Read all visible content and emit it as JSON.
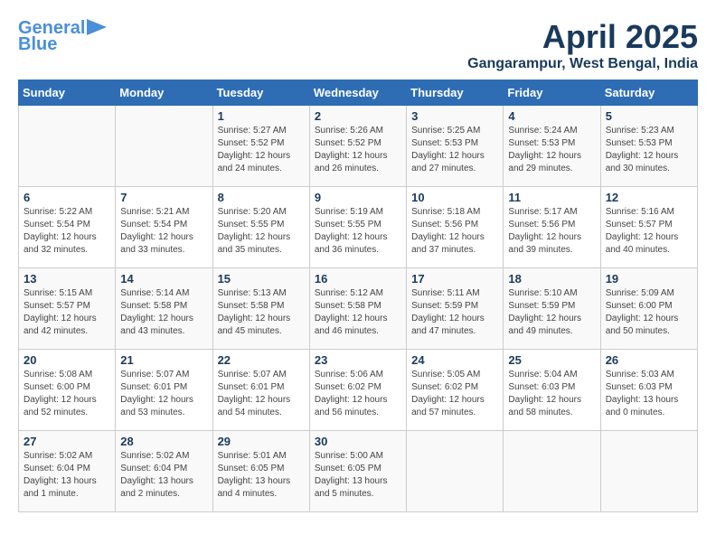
{
  "header": {
    "logo_line1": "General",
    "logo_line2": "Blue",
    "month_year": "April 2025",
    "location": "Gangarampur, West Bengal, India"
  },
  "days_of_week": [
    "Sunday",
    "Monday",
    "Tuesday",
    "Wednesday",
    "Thursday",
    "Friday",
    "Saturday"
  ],
  "weeks": [
    [
      {
        "day": "",
        "info": ""
      },
      {
        "day": "",
        "info": ""
      },
      {
        "day": "1",
        "info": "Sunrise: 5:27 AM\nSunset: 5:52 PM\nDaylight: 12 hours\nand 24 minutes."
      },
      {
        "day": "2",
        "info": "Sunrise: 5:26 AM\nSunset: 5:52 PM\nDaylight: 12 hours\nand 26 minutes."
      },
      {
        "day": "3",
        "info": "Sunrise: 5:25 AM\nSunset: 5:53 PM\nDaylight: 12 hours\nand 27 minutes."
      },
      {
        "day": "4",
        "info": "Sunrise: 5:24 AM\nSunset: 5:53 PM\nDaylight: 12 hours\nand 29 minutes."
      },
      {
        "day": "5",
        "info": "Sunrise: 5:23 AM\nSunset: 5:53 PM\nDaylight: 12 hours\nand 30 minutes."
      }
    ],
    [
      {
        "day": "6",
        "info": "Sunrise: 5:22 AM\nSunset: 5:54 PM\nDaylight: 12 hours\nand 32 minutes."
      },
      {
        "day": "7",
        "info": "Sunrise: 5:21 AM\nSunset: 5:54 PM\nDaylight: 12 hours\nand 33 minutes."
      },
      {
        "day": "8",
        "info": "Sunrise: 5:20 AM\nSunset: 5:55 PM\nDaylight: 12 hours\nand 35 minutes."
      },
      {
        "day": "9",
        "info": "Sunrise: 5:19 AM\nSunset: 5:55 PM\nDaylight: 12 hours\nand 36 minutes."
      },
      {
        "day": "10",
        "info": "Sunrise: 5:18 AM\nSunset: 5:56 PM\nDaylight: 12 hours\nand 37 minutes."
      },
      {
        "day": "11",
        "info": "Sunrise: 5:17 AM\nSunset: 5:56 PM\nDaylight: 12 hours\nand 39 minutes."
      },
      {
        "day": "12",
        "info": "Sunrise: 5:16 AM\nSunset: 5:57 PM\nDaylight: 12 hours\nand 40 minutes."
      }
    ],
    [
      {
        "day": "13",
        "info": "Sunrise: 5:15 AM\nSunset: 5:57 PM\nDaylight: 12 hours\nand 42 minutes."
      },
      {
        "day": "14",
        "info": "Sunrise: 5:14 AM\nSunset: 5:58 PM\nDaylight: 12 hours\nand 43 minutes."
      },
      {
        "day": "15",
        "info": "Sunrise: 5:13 AM\nSunset: 5:58 PM\nDaylight: 12 hours\nand 45 minutes."
      },
      {
        "day": "16",
        "info": "Sunrise: 5:12 AM\nSunset: 5:58 PM\nDaylight: 12 hours\nand 46 minutes."
      },
      {
        "day": "17",
        "info": "Sunrise: 5:11 AM\nSunset: 5:59 PM\nDaylight: 12 hours\nand 47 minutes."
      },
      {
        "day": "18",
        "info": "Sunrise: 5:10 AM\nSunset: 5:59 PM\nDaylight: 12 hours\nand 49 minutes."
      },
      {
        "day": "19",
        "info": "Sunrise: 5:09 AM\nSunset: 6:00 PM\nDaylight: 12 hours\nand 50 minutes."
      }
    ],
    [
      {
        "day": "20",
        "info": "Sunrise: 5:08 AM\nSunset: 6:00 PM\nDaylight: 12 hours\nand 52 minutes."
      },
      {
        "day": "21",
        "info": "Sunrise: 5:07 AM\nSunset: 6:01 PM\nDaylight: 12 hours\nand 53 minutes."
      },
      {
        "day": "22",
        "info": "Sunrise: 5:07 AM\nSunset: 6:01 PM\nDaylight: 12 hours\nand 54 minutes."
      },
      {
        "day": "23",
        "info": "Sunrise: 5:06 AM\nSunset: 6:02 PM\nDaylight: 12 hours\nand 56 minutes."
      },
      {
        "day": "24",
        "info": "Sunrise: 5:05 AM\nSunset: 6:02 PM\nDaylight: 12 hours\nand 57 minutes."
      },
      {
        "day": "25",
        "info": "Sunrise: 5:04 AM\nSunset: 6:03 PM\nDaylight: 12 hours\nand 58 minutes."
      },
      {
        "day": "26",
        "info": "Sunrise: 5:03 AM\nSunset: 6:03 PM\nDaylight: 13 hours\nand 0 minutes."
      }
    ],
    [
      {
        "day": "27",
        "info": "Sunrise: 5:02 AM\nSunset: 6:04 PM\nDaylight: 13 hours\nand 1 minute."
      },
      {
        "day": "28",
        "info": "Sunrise: 5:02 AM\nSunset: 6:04 PM\nDaylight: 13 hours\nand 2 minutes."
      },
      {
        "day": "29",
        "info": "Sunrise: 5:01 AM\nSunset: 6:05 PM\nDaylight: 13 hours\nand 4 minutes."
      },
      {
        "day": "30",
        "info": "Sunrise: 5:00 AM\nSunset: 6:05 PM\nDaylight: 13 hours\nand 5 minutes."
      },
      {
        "day": "",
        "info": ""
      },
      {
        "day": "",
        "info": ""
      },
      {
        "day": "",
        "info": ""
      }
    ]
  ]
}
